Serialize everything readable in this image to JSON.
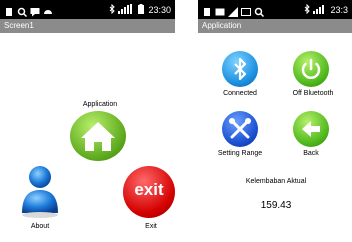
{
  "left": {
    "status": {
      "time": "23:30"
    },
    "title": "Screen1",
    "application_label": "Application",
    "about_label": "About",
    "exit_label": "Exit",
    "exit_icon_text": "exit"
  },
  "right": {
    "status": {
      "time": "23:3"
    },
    "title": "Application",
    "connected_label": "Connected",
    "off_bluetooth_label": "Off Bluetooth",
    "setting_range_label": "Setting Range",
    "back_label": "Back",
    "sensor_label": "Kelembaban Aktual",
    "sensor_value": "159.43"
  }
}
